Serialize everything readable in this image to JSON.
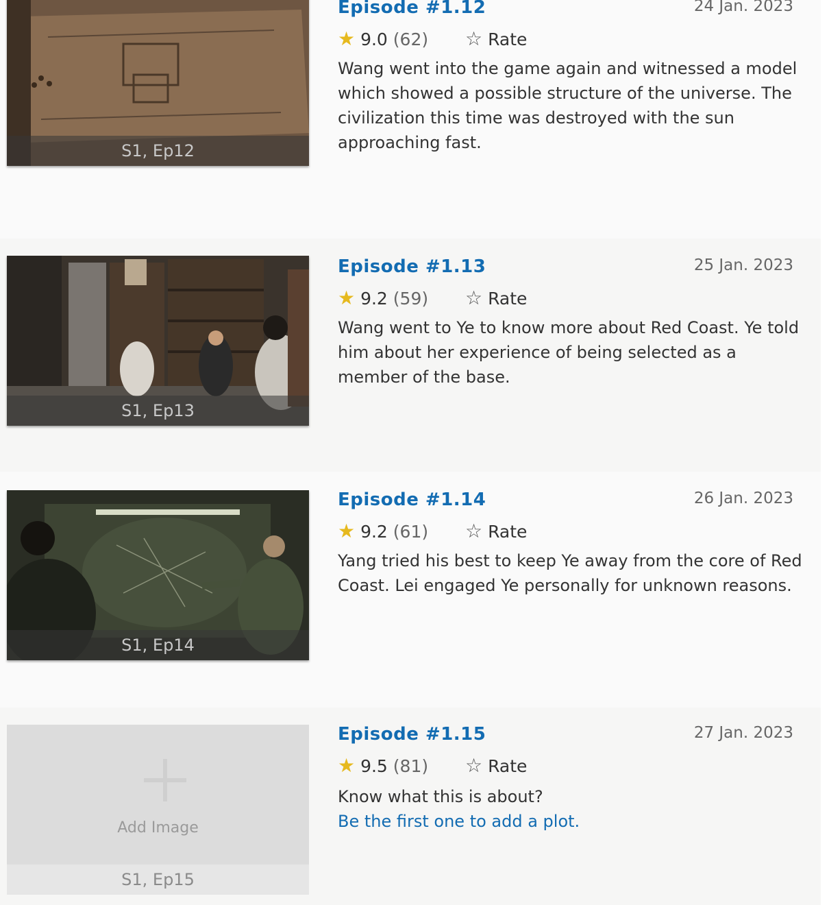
{
  "episodes": [
    {
      "title": "Episode #1.12",
      "date": "24 Jan. 2023",
      "rating": "9.0",
      "votes": "(62)",
      "rate_label": "Rate",
      "caption": "S1, Ep12",
      "plot": "Wang went into the game again and witnessed a model which showed a possible structure of the universe. The civilization this time was destroyed with the sun approaching fast."
    },
    {
      "title": "Episode #1.13",
      "date": "25 Jan. 2023",
      "rating": "9.2",
      "votes": "(59)",
      "rate_label": "Rate",
      "caption": "S1, Ep13",
      "plot": "Wang went to Ye to know more about Red Coast. Ye told him about her experience of being selected as a member of the base."
    },
    {
      "title": "Episode #1.14",
      "date": "26 Jan. 2023",
      "rating": "9.2",
      "votes": "(61)",
      "rate_label": "Rate",
      "caption": "S1, Ep14",
      "plot": "Yang tried his best to keep Ye away from the core of Red Coast. Lei engaged Ye personally for unknown reasons."
    },
    {
      "title": "Episode #1.15",
      "date": "27 Jan. 2023",
      "rating": "9.5",
      "votes": "(81)",
      "rate_label": "Rate",
      "caption": "S1, Ep15",
      "add_image_label": "Add Image",
      "plot_prompt": "Know what this is about?",
      "plot_link": "Be the first one to add a plot."
    }
  ],
  "icons": {
    "rating_star": "star-filled-icon",
    "rate_star": "star-outline-icon",
    "add_image": "plus-icon"
  },
  "colors": {
    "link": "#136cb2",
    "star": "#e6b91e"
  }
}
